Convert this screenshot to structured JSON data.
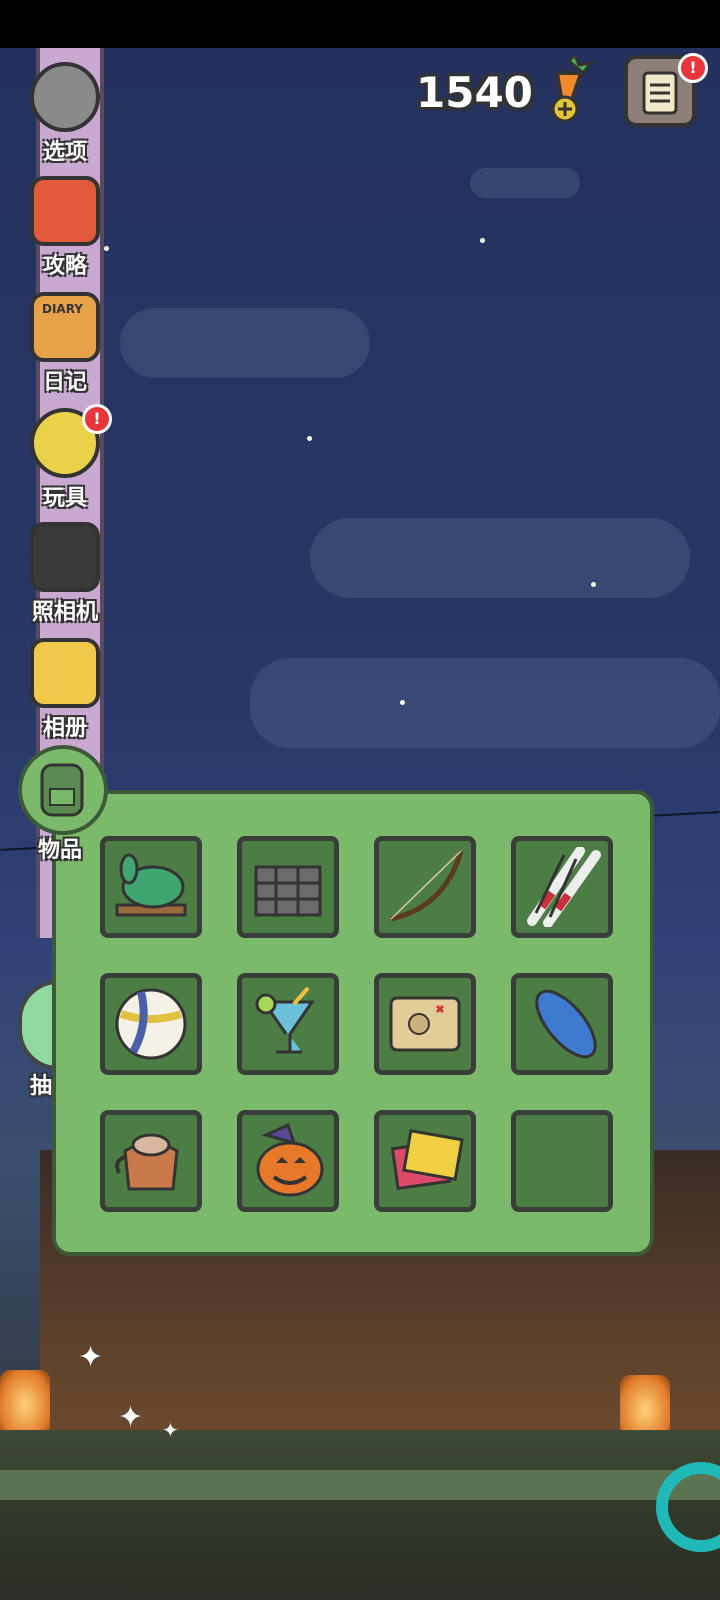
{
  "score": {
    "carrots": "1540"
  },
  "sidebar": {
    "items": [
      {
        "label": "选项",
        "icon": "gear-icon"
      },
      {
        "label": "攻略",
        "icon": "guide-book-icon"
      },
      {
        "label": "日记",
        "icon": "diary-icon",
        "cover_text": "DIARY"
      },
      {
        "label": "玩具",
        "icon": "toy-balls-icon",
        "badge": "!"
      },
      {
        "label": "照相机",
        "icon": "camera-icon"
      },
      {
        "label": "相册",
        "icon": "photo-album-icon"
      },
      {
        "label": "物品",
        "icon": "backpack-icon"
      }
    ],
    "partial_label": "抽"
  },
  "menu": {
    "badge": "!"
  },
  "inventory": {
    "slots": [
      {
        "item": "jade-rabbit-statue-icon"
      },
      {
        "item": "wooden-crate-icon"
      },
      {
        "item": "bow-icon"
      },
      {
        "item": "skis-and-poles-icon"
      },
      {
        "item": "volleyball-icon"
      },
      {
        "item": "tropical-drink-icon"
      },
      {
        "item": "treasure-map-icon"
      },
      {
        "item": "surfboard-icon"
      },
      {
        "item": "teapot-icon"
      },
      {
        "item": "jack-o-lantern-icon"
      },
      {
        "item": "picture-cards-icon"
      },
      {
        "item": "empty"
      }
    ]
  },
  "colors": {
    "panel": "#7cba6b",
    "slot": "#4c7d45",
    "sky": "#24315f",
    "badge": "#e8343a"
  }
}
